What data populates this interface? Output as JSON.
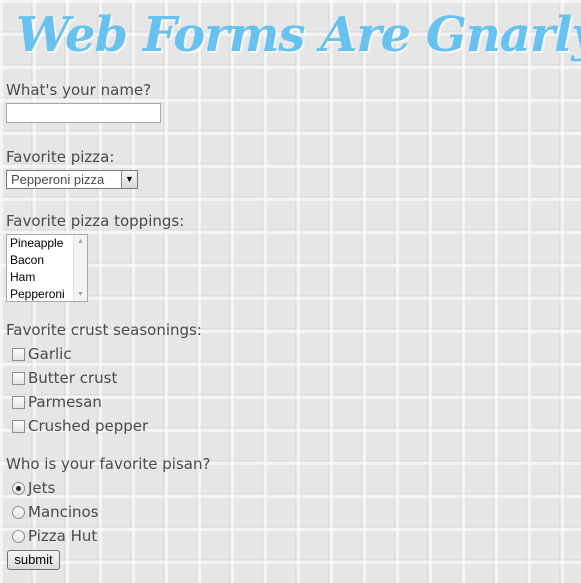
{
  "page": {
    "title": "Web Forms Are Gnarly!"
  },
  "form": {
    "name_question": "What's your name?",
    "name_value": "",
    "pizza_question": "Favorite pizza:",
    "pizza_selected": "Pepperoni pizza",
    "pizza_arrow_icon": "▼",
    "toppings_question": "Favorite pizza toppings:",
    "toppings_options": [
      "Pineapple",
      "Bacon",
      "Ham",
      "Pepperoni"
    ],
    "seasonings_question": "Favorite crust seasonings:",
    "seasonings": [
      {
        "label": "Garlic",
        "checked": false
      },
      {
        "label": "Butter crust",
        "checked": false
      },
      {
        "label": "Parmesan",
        "checked": false
      },
      {
        "label": "Crushed pepper",
        "checked": false
      }
    ],
    "pisan_question": "Who is your favorite pisan?",
    "pisans": [
      {
        "label": "Jets",
        "checked": true
      },
      {
        "label": "Mancinos",
        "checked": false
      },
      {
        "label": "Pizza Hut",
        "checked": false
      }
    ],
    "submit_label": "submit"
  },
  "colors": {
    "title": "#67c2f0",
    "background": "#e6e6e6",
    "text": "#4a4a4a"
  }
}
